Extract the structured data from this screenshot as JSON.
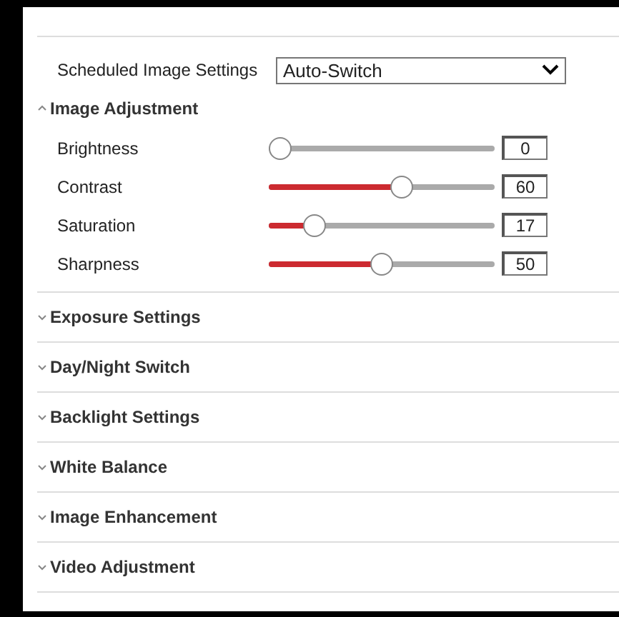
{
  "scheduled": {
    "label": "Scheduled Image Settings",
    "value": "Auto-Switch"
  },
  "sections": [
    {
      "title": "Image Adjustment",
      "expanded": true,
      "sliders": [
        {
          "name": "Brightness",
          "level": 0,
          "reading": "0"
        },
        {
          "name": "Contrast",
          "level": 0.6,
          "reading": "60"
        },
        {
          "name": "Saturation",
          "level": 0.17,
          "reading": "17"
        },
        {
          "name": "Sharpness",
          "level": 0.5,
          "reading": "50"
        }
      ]
    },
    {
      "title": "Exposure Settings",
      "expanded": false
    },
    {
      "title": "Day/Night Switch",
      "expanded": false
    },
    {
      "title": "Backlight Settings",
      "expanded": false
    },
    {
      "title": "White Balance",
      "expanded": false
    },
    {
      "title": "Image Enhancement",
      "expanded": false
    },
    {
      "title": "Video Adjustment",
      "expanded": false
    }
  ]
}
